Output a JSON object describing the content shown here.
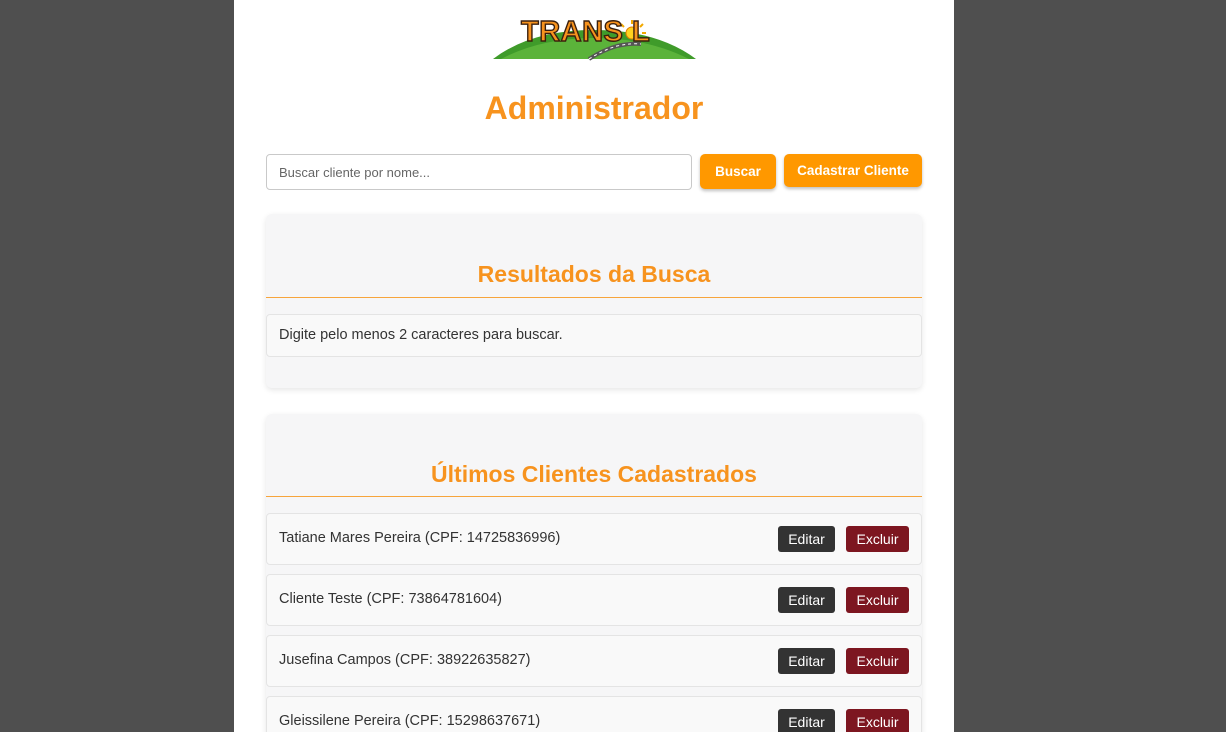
{
  "logo": {
    "text": "TRANS L"
  },
  "header": {
    "title": "Administrador"
  },
  "search": {
    "placeholder": "Buscar cliente por nome...",
    "value": "",
    "button_label": "Buscar"
  },
  "register_button_label": "Cadastrar Cliente",
  "results": {
    "title": "Resultados da Busca",
    "message": "Digite pelo menos 2 caracteres para buscar."
  },
  "recent": {
    "title": "Últimos Clientes Cadastrados",
    "edit_label": "Editar",
    "delete_label": "Excluir",
    "clients": [
      {
        "label": "Tatiane Mares Pereira (CPF: 14725836996)"
      },
      {
        "label": "Cliente Teste (CPF: 73864781604)"
      },
      {
        "label": "Jusefina Campos (CPF: 38922635827)"
      },
      {
        "label": "Gleissilene Pereira (CPF: 15298637671)"
      }
    ]
  },
  "colors": {
    "accent": "#ff9800",
    "title_orange": "#f7931e",
    "edit_button": "#333333",
    "delete_button": "#7d1620",
    "backdrop": "#4f4f4f"
  }
}
